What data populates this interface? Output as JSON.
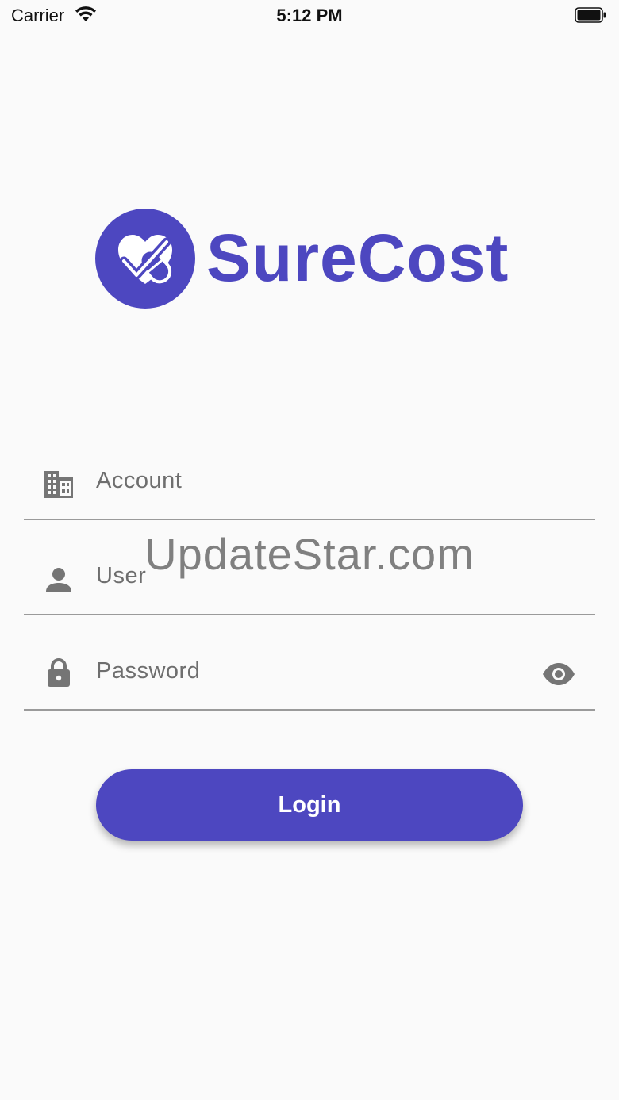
{
  "status_bar": {
    "carrier": "Carrier",
    "time": "5:12 PM"
  },
  "brand": {
    "name": "SureCost",
    "color": "#4d47c0"
  },
  "form": {
    "account_placeholder": "Account",
    "user_placeholder": "User",
    "password_placeholder": "Password",
    "account_icon": "building-icon",
    "user_icon": "person-icon",
    "password_icon": "lock-icon",
    "visibility_icon": "eye-icon"
  },
  "watermark": "UpdateStar.com",
  "login_button": {
    "label": "Login",
    "color": "#4d47c0"
  }
}
